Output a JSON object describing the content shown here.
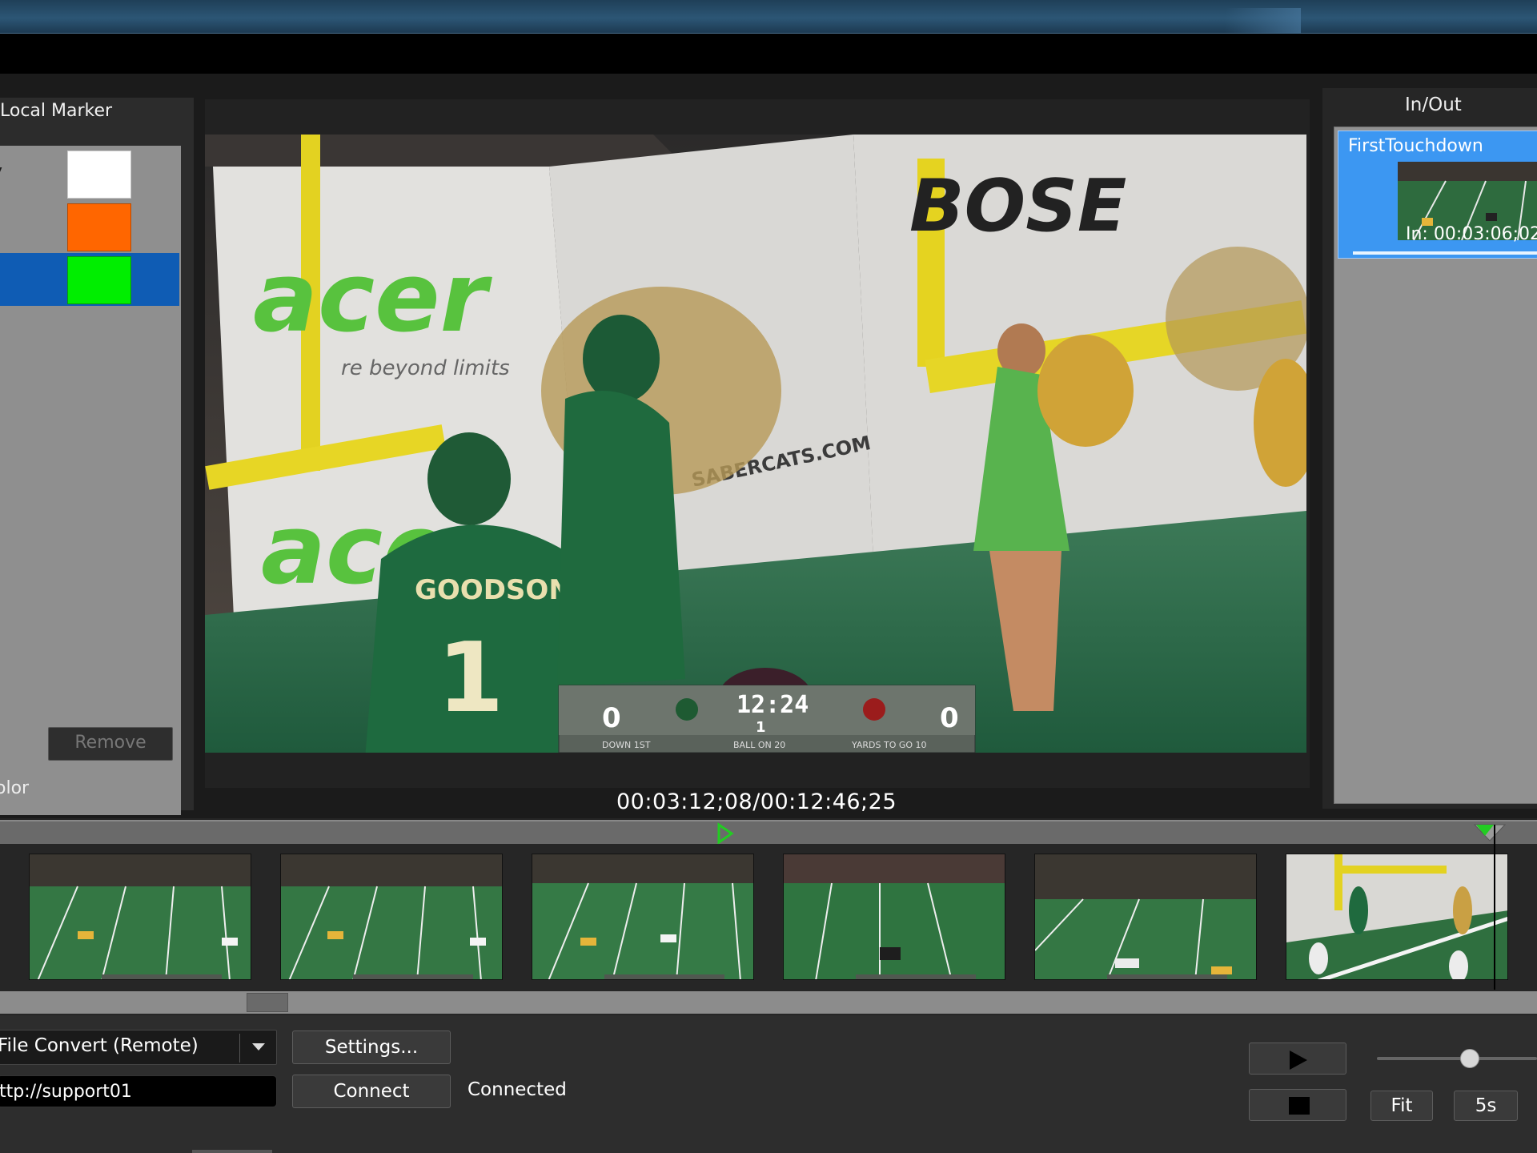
{
  "local_marker": {
    "title": "Local Marker",
    "markers": [
      {
        "label": "y",
        "color": "#ffffff"
      },
      {
        "label": "",
        "color": "#ff6600"
      },
      {
        "label": "",
        "color": "#00ee00",
        "selected": true
      }
    ],
    "remove_label": "Remove",
    "color_label": "olor"
  },
  "player": {
    "timecode": "00:03:12;08/00:12:46;25"
  },
  "in_out": {
    "title": "In/Out",
    "clips": [
      {
        "name": "FirstTouchdown",
        "in": "In: 00:03:06;02"
      }
    ]
  },
  "controls": {
    "convert_mode": "File Convert (Remote)",
    "settings_label": "Settings...",
    "server_url": "ttp://support01",
    "connect_label": "Connect",
    "connection_status": "Connected",
    "fit_label": "Fit",
    "step_label": "5s",
    "zoom_level": 0.47
  },
  "colors": {
    "selection_blue": "#0f5cb4",
    "clip_highlight": "#3c97f2",
    "marker_green": "#22cc22"
  }
}
